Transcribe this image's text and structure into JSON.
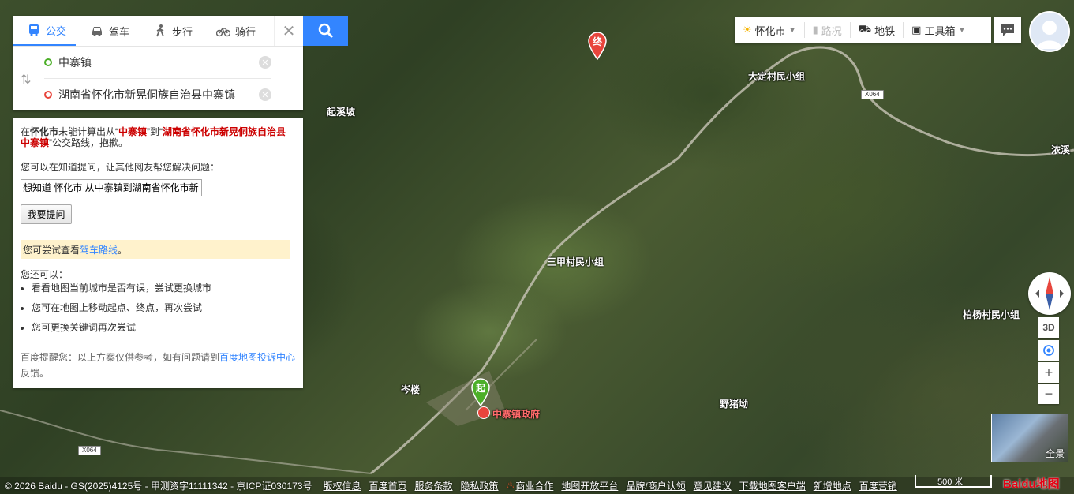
{
  "tabs": [
    {
      "label": "公交",
      "icon": "bus-icon",
      "active": true
    },
    {
      "label": "驾车",
      "icon": "car-icon",
      "active": false
    },
    {
      "label": "步行",
      "icon": "walk-icon",
      "active": false
    },
    {
      "label": "骑行",
      "icon": "bike-icon",
      "active": false
    }
  ],
  "route": {
    "start": "中寨镇",
    "end": "湖南省怀化市新晃侗族自治县中寨镇"
  },
  "result": {
    "msg_prefix": "在",
    "city": "怀化市",
    "msg_mid1": "未能计算出从“",
    "from": "中寨镇",
    "msg_mid2": "”到“",
    "to": "湖南省怀化市新晃侗族自治县中寨镇",
    "msg_suffix": "”公交路线，抱歉。",
    "ask_hint": "您可以在知道提问，让其他网友帮您解决问题：",
    "ask_input_value": "想知道 怀化市 从中寨镇到湖南省怀化市新",
    "ask_button": "我要提问",
    "try_prefix": "您可尝试查看",
    "try_link": "驾车路线",
    "try_suffix": "。",
    "also_title": "您还可以：",
    "tips": [
      "看看地图当前城市是否有误，尝试更换城市",
      "您可在地图上移动起点、终点，再次尝试",
      "您可更换关键词再次尝试"
    ],
    "disclaim_prefix": "百度提醒您：以上方案仅供参考，如有问题请到",
    "disclaim_link": "百度地图投诉中心",
    "disclaim_suffix": "反馈。"
  },
  "toolbar": {
    "city": "怀化市",
    "traffic": "路况",
    "subway": "地铁",
    "tools": "工具箱"
  },
  "map": {
    "labels": [
      "大定村民小组",
      "起溪坡",
      "浓溪",
      "三甲村民小组",
      "柏杨村民小组",
      "岑楼",
      "野猪坳",
      "中寨镇政府"
    ],
    "roads": [
      "X064",
      "X064"
    ],
    "start_marker": "起",
    "end_marker": "终"
  },
  "controls": {
    "threed": "3D",
    "zoom_in": "+",
    "zoom_out": "−",
    "pano": "全景"
  },
  "footer": {
    "copyright": "© 2026 Baidu - GS(2025)4125号 - 甲测资字11111342 - 京ICP证030173号",
    "links": [
      "版权信息",
      "百度首页",
      "服务条款",
      "隐私政策",
      "商业合作",
      "地图开放平台",
      "品牌/商户认领",
      "意见建议",
      "下载地图客户端",
      "新增地点",
      "百度营销"
    ],
    "scale": "500 米",
    "logo": "Baidu地图"
  },
  "colors": {
    "accent": "#3385ff",
    "red": "#c00000",
    "marker_green": "#4caf28",
    "marker_red": "#e8453c"
  }
}
